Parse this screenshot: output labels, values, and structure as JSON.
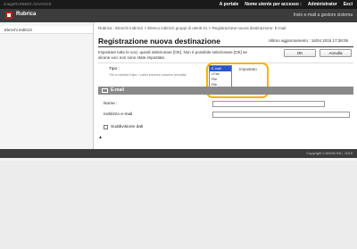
{
  "topbar": {
    "brand": "imageRUNNER ADVANCE",
    "portal_link": "A portale",
    "user_label": "Nome utente per accesso :",
    "user_name": "Administrator",
    "logout": "Esci"
  },
  "header": {
    "title": "Rubrica",
    "email_admin": "Invio e-mail a gestore sistema"
  },
  "sidebar": {
    "items": [
      {
        "label": "Elenchi indirizzi"
      }
    ]
  },
  "main": {
    "breadcrumb": "Rubrica : Elenchi indirizzi > Elenco indirizzi gruppi di utenti 01 > Registrazione nuova destinazione: E-mail",
    "page_title": "Registrazione nuova destinazione",
    "last_updated": "Ultimo aggiornamento : 16/04 2015 17:38:05",
    "info_text": "Impostare tutte le voci, quindi selezionare [OK]. Non è possibile selezionare [OK] se alcune voci non sono state impostate.",
    "ok_button": "OK",
    "cancel_button": "Annulla",
    "type_label": "Tipo :",
    "type_note": "*Se si cambia il tipo, i valori immessi saranno annullati.",
    "type_value": "Impostato",
    "type_options": [
      "E-mail",
      "I-Fax",
      "File",
      "File"
    ],
    "selected_type": "E-mail",
    "section_title": "E-mail",
    "name_label": "Nome :",
    "name_value": "",
    "email_label": "Indirizzo e-mail",
    "email_value": "",
    "split_label": "Suddivisione dati",
    "split_checked": false
  },
  "footer": {
    "copyright": "Copyright CANON INC. 2015"
  },
  "colors": {
    "accent": "#c41a1a",
    "highlight": "#f5b400",
    "selection": "#2a55d0"
  }
}
